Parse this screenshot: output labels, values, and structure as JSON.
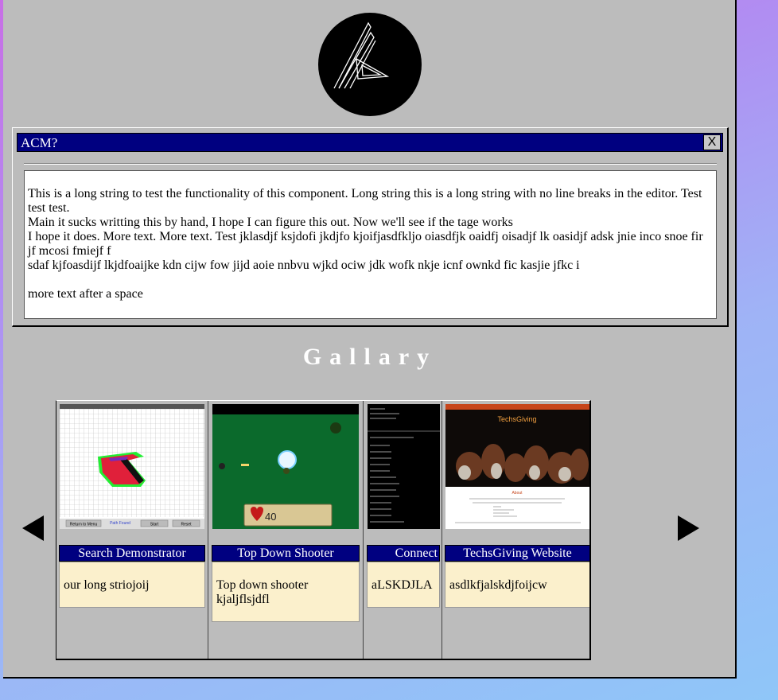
{
  "window": {
    "title": "ACM?",
    "close_label": "X",
    "content": "This is a long string to test the functionality of this component. Long string this is a long string with no line breaks in the editor. Test test test.\nMain it sucks writting this by hand, I hope I can figure this out. Now we'll see if the tage works\nI hope it does. More text. More text. Test jklasdjf ksjdofi jkdjfo kjoifjasdfkljo oiasdfjk oaidfj oisadjf lk oasidjf adsk jnie inco snoe fir jf mcosi fmiejf f\nsdaf kjfoasdijf lkjdfoaijke kdn cijw fow jijd aoie nnbvu wjkd ociw jdk wofk nkje icnf ownkd fic kasjie jfkc i\n\nmore text after a space"
  },
  "gallery": {
    "heading": "Gallary",
    "cards": [
      {
        "title": "Search Demonstrator",
        "description": "our long striojoij",
        "thumb_buttons": [
          "Return to Menu",
          "Path Found",
          "Start",
          "Reset"
        ]
      },
      {
        "title": "Top Down Shooter",
        "description": "Top down shooter kjaljflsjdfl",
        "thumb_health": "40"
      },
      {
        "title": "Connect",
        "description": "aLSKDJLA"
      },
      {
        "title": "TechsGiving Website",
        "description": "asdlkfjalskdjfoijcw",
        "thumb_banner": "TechsGiving",
        "thumb_subhead": "About"
      }
    ]
  },
  "icons": {
    "prev": "arrow-left-icon",
    "next": "arrow-right-icon",
    "logo": "acm-logo"
  }
}
